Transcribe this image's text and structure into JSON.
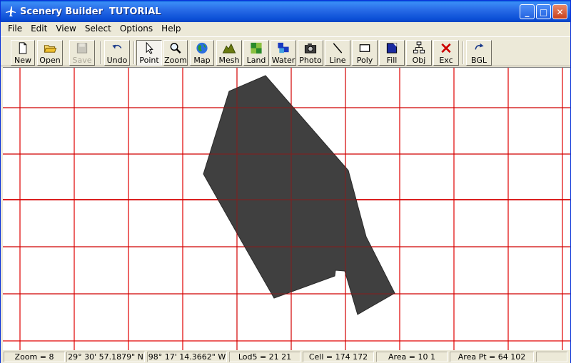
{
  "window": {
    "title": "Scenery Builder  TUTORIAL"
  },
  "caption_buttons": {
    "minimize": "_",
    "maximize": "□",
    "close": "✕"
  },
  "menu": [
    "File",
    "Edit",
    "View",
    "Select",
    "Options",
    "Help"
  ],
  "toolbar": {
    "new": "New",
    "open": "Open",
    "save": "Save",
    "undo": "Undo",
    "point": "Point",
    "zoom": "Zoom",
    "map": "Map",
    "mesh": "Mesh",
    "land": "Land",
    "water": "Water",
    "photo": "Photo",
    "line": "Line",
    "poly": "Poly",
    "fill": "Fill",
    "obj": "Obj",
    "exc": "Exc",
    "bgl": "BGL"
  },
  "icons": {
    "new": "new-document-icon",
    "open": "open-folder-icon",
    "save": "save-disk-icon",
    "undo": "undo-arrow-icon",
    "point": "pointer-arrow-icon",
    "zoom": "magnifier-icon",
    "map": "globe-icon",
    "mesh": "mountain-icon",
    "land": "land-tiles-icon",
    "water": "water-tiles-icon",
    "photo": "camera-icon",
    "line": "line-icon",
    "poly": "polygon-icon",
    "fill": "fill-icon",
    "obj": "object-tree-icon",
    "exc": "exclude-x-icon",
    "bgl": "compile-arrow-icon"
  },
  "status": {
    "zoom": "Zoom = 8",
    "lat": "29° 30' 57.1879\" N",
    "lon": "98° 17' 14.3662\" W",
    "lod5": "Lod5 = 21 21",
    "cell": "Cell = 174 172",
    "area": "Area = 10 1",
    "area_pt": "Area Pt = 64 102"
  },
  "colors": {
    "grid": "#e00000",
    "polygon": "#404040",
    "titlebar": "#0b4fd6"
  }
}
